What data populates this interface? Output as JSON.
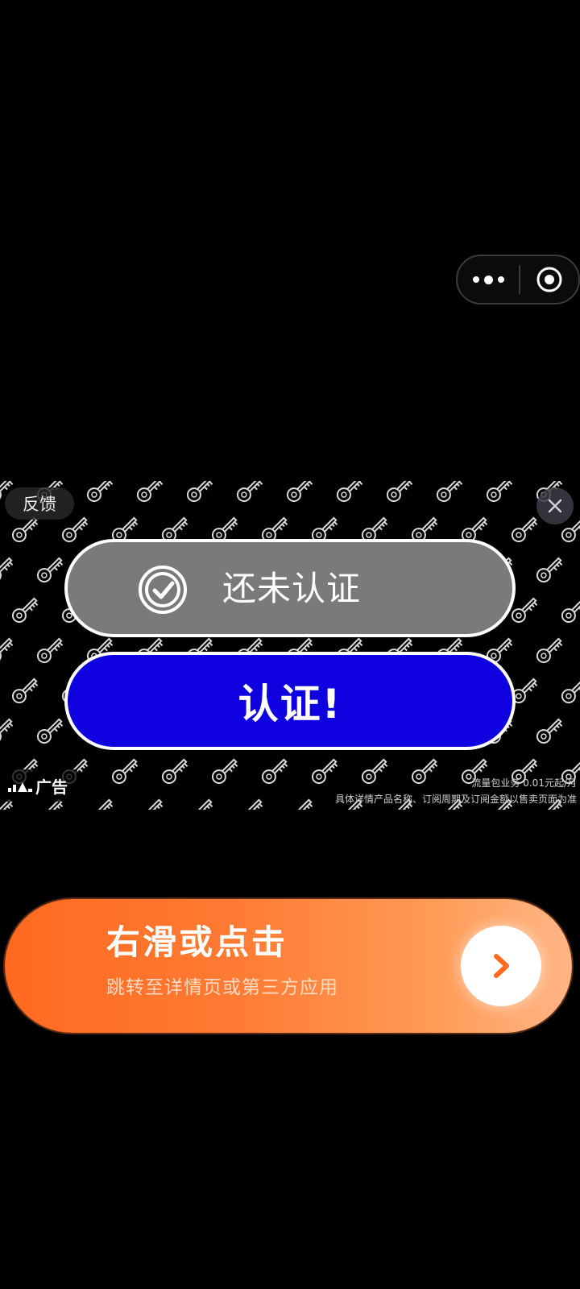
{
  "capsule": {
    "more_icon": "more-dots-icon",
    "close_icon": "target-close-icon"
  },
  "ad_banner": {
    "feedback_label": "反馈",
    "close_icon": "close-x-icon",
    "background_icon": "key-icon",
    "status_label": "还未认证",
    "status_icon": "check-circle-icon",
    "status_color": "#7a7a7a",
    "verify_button_label": "认证!",
    "verify_button_color": "#0f00e0",
    "ad_tag_label": "广告",
    "disclaimer_line1": "流量包业务 0.01元起/月",
    "disclaimer_line2": "具体详情产品名称、订阅周期及订阅金额以售卖页面为准"
  },
  "swipe_cta": {
    "title": "右滑或点击",
    "subtitle": "跳转至详情页或第三方应用",
    "arrow_icon": "chevron-right-icon",
    "gradient_start": "#ff6a1f",
    "gradient_end": "#ffb585"
  }
}
